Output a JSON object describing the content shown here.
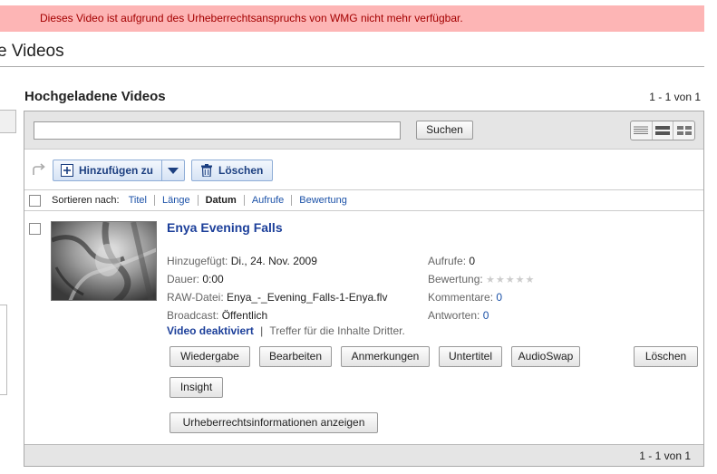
{
  "alert": {
    "text": "Dieses Video ist aufgrund des Urheberrechtsanspruchs von WMG nicht mehr verfügbar."
  },
  "page": {
    "title_fragment": "e Videos"
  },
  "section": {
    "title": "Hochgeladene Videos",
    "count_top": "1 - 1 von 1",
    "count_bottom": "1 - 1 von 1"
  },
  "search": {
    "value": "",
    "button_label": "Suchen"
  },
  "view_toggle": {
    "icons": [
      "list-view-icon",
      "compact-view-icon",
      "grid-view-icon"
    ]
  },
  "toolbar": {
    "add_label": "Hinzufügen zu",
    "delete_label": "Löschen"
  },
  "sort": {
    "label": "Sortieren nach:",
    "options": [
      "Titel",
      "Länge",
      "Datum",
      "Aufrufe",
      "Bewertung"
    ],
    "active": "Datum"
  },
  "video": {
    "title": "Enya Evening Falls",
    "added_label": "Hinzugefügt:",
    "added_value": "Di., 24. Nov. 2009",
    "duration_label": "Dauer:",
    "duration_value": "0:00",
    "raw_label": "RAW-Datei:",
    "raw_value": "Enya_-_Evening_Falls-1-Enya.flv",
    "broadcast_label": "Broadcast:",
    "broadcast_value": "Öffentlich",
    "views_label": "Aufrufe:",
    "views_value": "0",
    "rating_label": "Bewertung:",
    "rating_stars": "★★★★★",
    "comments_label": "Kommentare:",
    "comments_value": "0",
    "replies_label": "Antworten:",
    "replies_value": "0",
    "status_link": "Video deaktiviert",
    "status_sep": "|",
    "status_text": "Treffer für die Inhalte Dritter.",
    "actions": {
      "play": "Wiedergabe",
      "edit": "Bearbeiten",
      "annotations": "Anmerkungen",
      "subtitles": "Untertitel",
      "audioswap": "AudioSwap",
      "delete": "Löschen",
      "insight": "Insight",
      "copyright": "Urheberrechtsinformationen anzeigen"
    }
  },
  "colors": {
    "alert_bg": "#fdb5b5",
    "alert_text": "#a40000",
    "link": "#1c52a8",
    "toolbar_bg": "#e5e5e5"
  }
}
